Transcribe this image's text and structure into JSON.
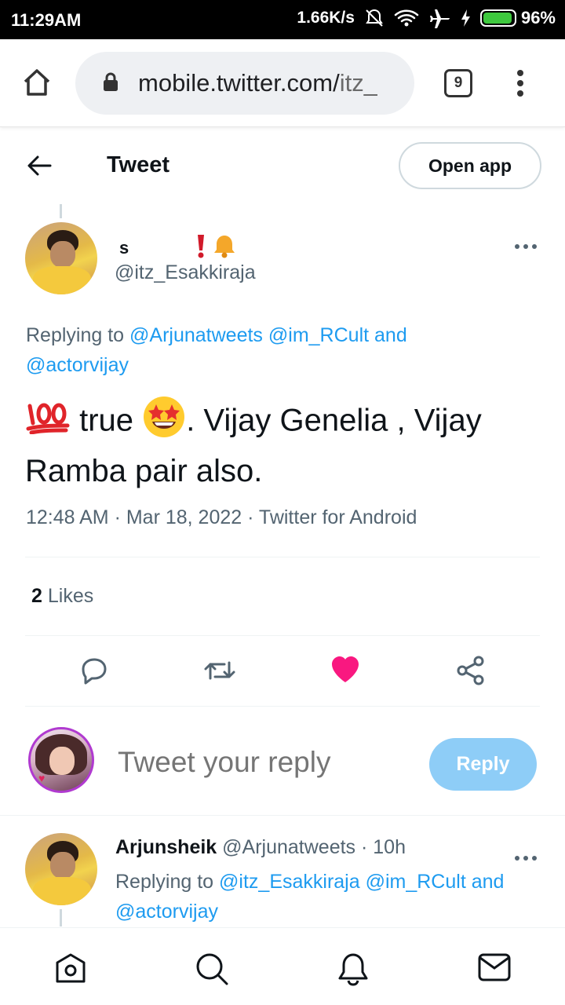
{
  "status_bar": {
    "time": "11:29AM",
    "speed": "1.66K/s",
    "battery": "96%",
    "battery_level": 0.96
  },
  "browser": {
    "url": "mobile.twitter.com/",
    "url_dim": "itz_",
    "tab_count": "9"
  },
  "header": {
    "title": "Tweet",
    "open_app_label": "Open app"
  },
  "tweet": {
    "display_name": "s",
    "handle": "@itz_Esakkiraja",
    "replying_prefix": "Replying to",
    "replying_to_1": "@Arjunatweets",
    "replying_to_2": "@im_RCult",
    "replying_and": "and",
    "replying_to_3": "@actorvijay",
    "text_part1": "true",
    "text_part2": ". Vijay Genelia , Vijay Ramba pair also.",
    "timestamp": "12:48 AM · Mar 18, 2022 · Twitter for Android",
    "likes_count": "2",
    "likes_label": "Likes"
  },
  "composer": {
    "placeholder": "Tweet your reply",
    "reply_label": "Reply"
  },
  "reply": {
    "name": "Arjunsheik",
    "handle_time": "@Arjunatweets · 10h",
    "replying_prefix": "Replying to",
    "replying_to_1": "@itz_Esakkiraja",
    "replying_to_2": "@im_RCult",
    "replying_and": "and",
    "replying_to_3": "@actorvijay"
  },
  "colors": {
    "link": "#1d9bf0",
    "like_active": "#f91880",
    "reply_button": "#8ecdf7"
  },
  "icons": {
    "nav": [
      "home-icon",
      "search-icon",
      "notifications-icon",
      "messages-icon"
    ],
    "actions": [
      "reply-icon",
      "retweet-icon",
      "like-icon",
      "share-icon"
    ]
  }
}
